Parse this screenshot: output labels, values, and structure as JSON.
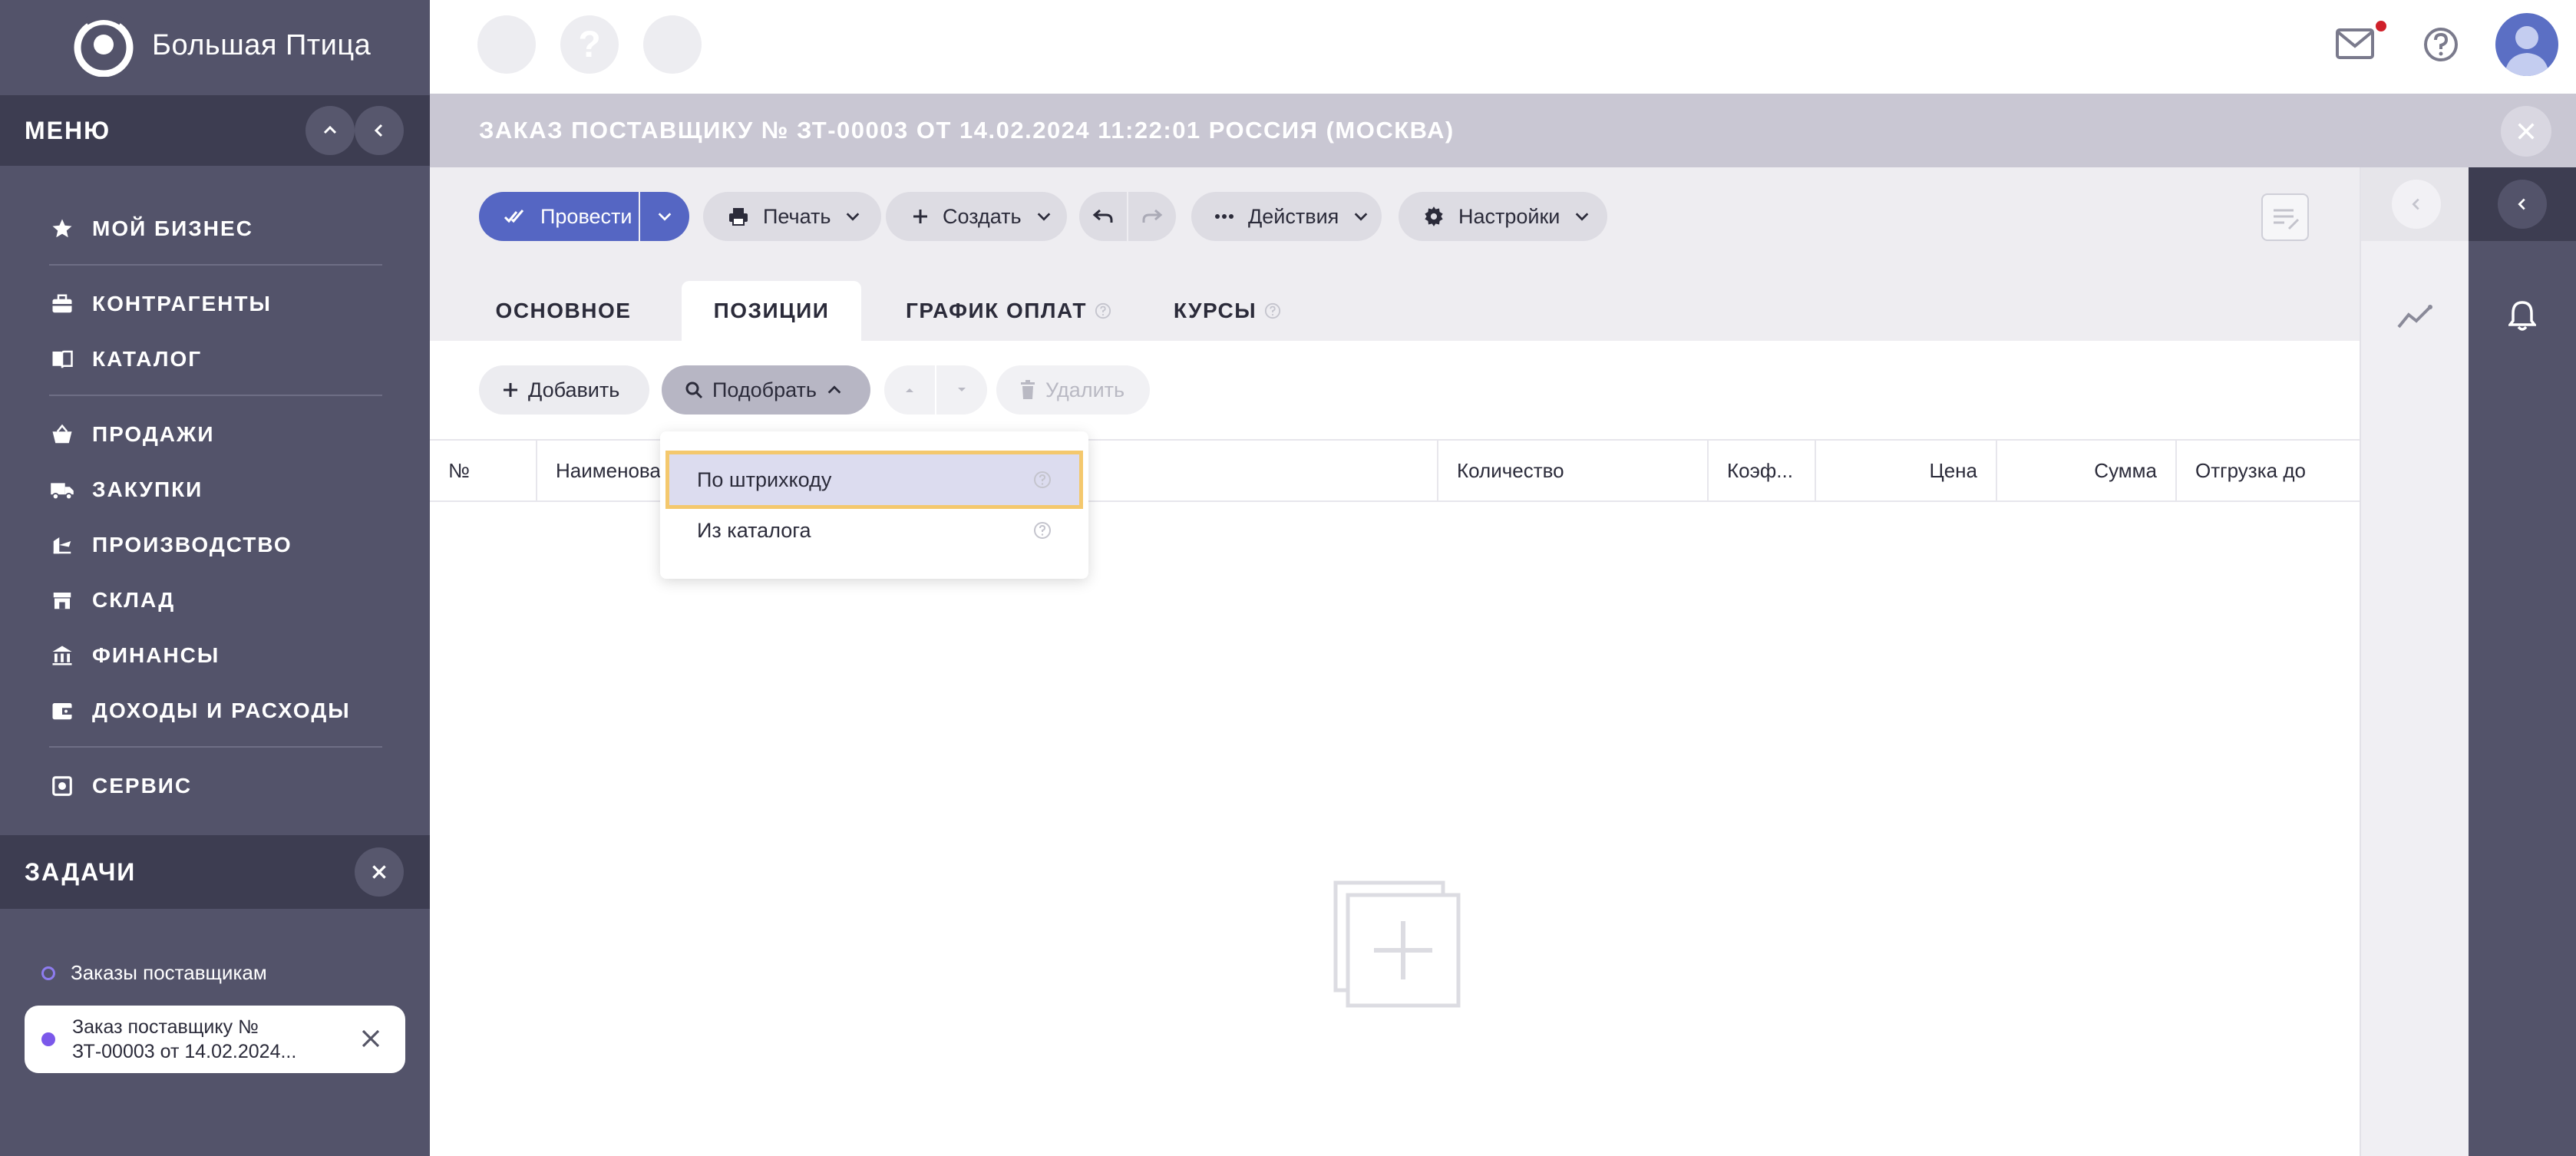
{
  "app": {
    "logo_text": "Большая Птица"
  },
  "sidebar": {
    "menu_title": "МЕНЮ",
    "items": [
      {
        "label": "МОЙ БИЗНЕС",
        "icon": "star-icon"
      },
      {
        "label": "КОНТРАГЕНТЫ",
        "icon": "briefcase-icon"
      },
      {
        "label": "КАТАЛОГ",
        "icon": "book-icon"
      },
      {
        "label": "ПРОДАЖИ",
        "icon": "basket-icon"
      },
      {
        "label": "ЗАКУПКИ",
        "icon": "truck-icon"
      },
      {
        "label": "ПРОИЗВОДСТВО",
        "icon": "factory-icon"
      },
      {
        "label": "СКЛАД",
        "icon": "warehouse-icon"
      },
      {
        "label": "ФИНАНСЫ",
        "icon": "bank-icon"
      },
      {
        "label": "ДОХОДЫ И РАСХОДЫ",
        "icon": "wallet-icon"
      },
      {
        "label": "СЕРВИС",
        "icon": "service-icon"
      }
    ],
    "tasks_title": "ЗАДАЧИ",
    "task_group": "Заказы поставщикам",
    "task_card": "Заказ поставщику № ЗТ-00003 от 14.02.2024..."
  },
  "topbar": {
    "help_glyph": "?"
  },
  "document": {
    "title": "ЗАКАЗ ПОСТАВЩИКУ № ЗТ-00003 ОТ 14.02.2024 11:22:01 РОССИЯ (МОСКВА)"
  },
  "toolbar": {
    "post_label": "Провести",
    "print_label": "Печать",
    "create_label": "Создать",
    "actions_label": "Действия",
    "settings_label": "Настройки"
  },
  "tabs": [
    {
      "label": "ОСНОВНОЕ",
      "active": false
    },
    {
      "label": "ПОЗИЦИИ",
      "active": true
    },
    {
      "label": "ГРАФИК ОПЛАТ",
      "active": false
    },
    {
      "label": "КУРСЫ",
      "active": false
    }
  ],
  "positions": {
    "add_label": "Добавить",
    "pick_label": "Подобрать",
    "delete_label": "Удалить",
    "columns": [
      "№",
      "Наименова",
      "Количество",
      "Коэф...",
      "Цена",
      "Сумма",
      "Отгрузка до"
    ]
  },
  "dropdown": {
    "items": [
      "По штрихкоду",
      "Из каталога"
    ]
  },
  "colors": {
    "sidebar": "#53536a",
    "sidebar_dark": "#3d3d51",
    "primary": "#5566c3",
    "highlight_outline": "#f4c86d",
    "notification": "#d0202a"
  }
}
